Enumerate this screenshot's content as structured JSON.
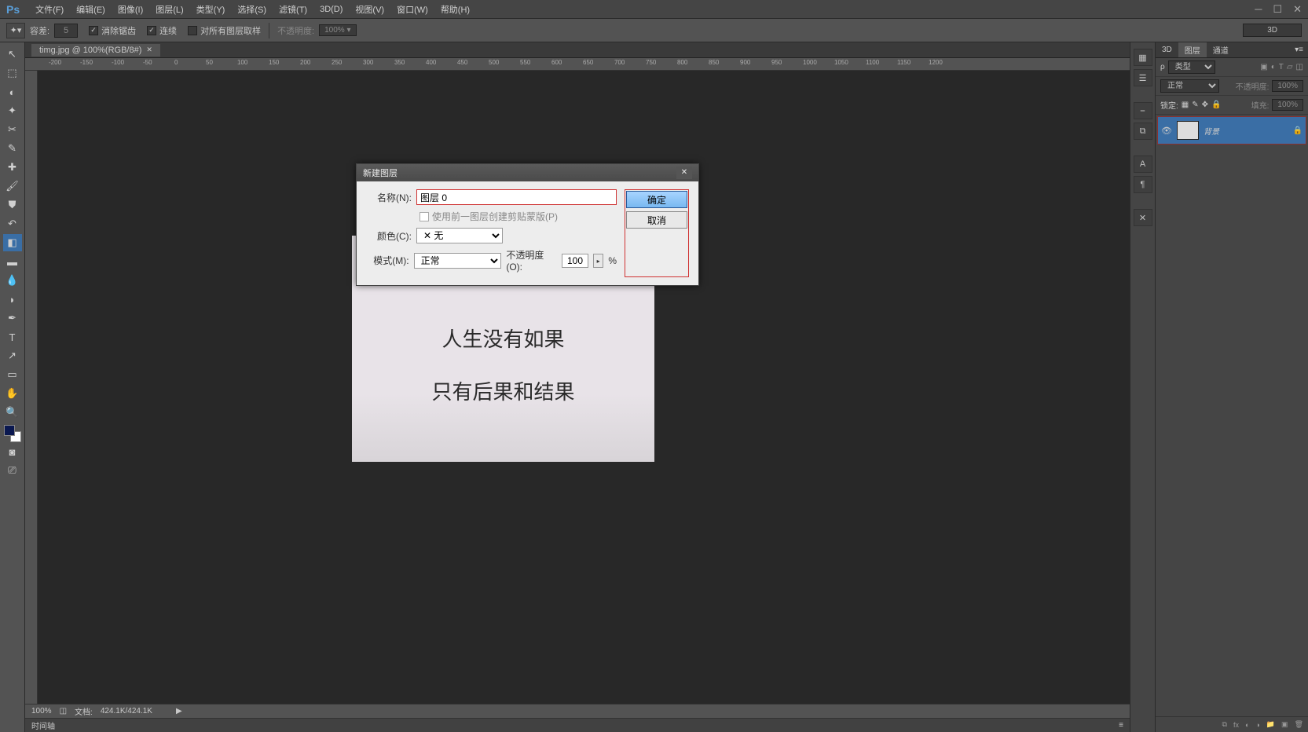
{
  "menubar": {
    "items": [
      "文件(F)",
      "编辑(E)",
      "图像(I)",
      "图层(L)",
      "类型(Y)",
      "选择(S)",
      "滤镜(T)",
      "3D(D)",
      "视图(V)",
      "窗口(W)",
      "帮助(H)"
    ]
  },
  "options": {
    "tolerance_label": "容差:",
    "tolerance_value": "5",
    "antialias": "消除锯齿",
    "contiguous": "连续",
    "all_layers": "对所有图层取样",
    "opacity_label": "不透明度:",
    "opacity_value": "100%",
    "three_d": "3D"
  },
  "document": {
    "tab_title": "timg.jpg @ 100%(RGB/8#)",
    "zoom": "100%",
    "doc_size_label": "文档:",
    "doc_size": "424.1K/424.1K",
    "timeline_label": "时间轴",
    "ruler_ticks": [
      "-200",
      "-150",
      "-100",
      "-50",
      "0",
      "50",
      "100",
      "150",
      "200",
      "250",
      "300",
      "350",
      "400",
      "450",
      "500",
      "550",
      "600",
      "650",
      "700",
      "750",
      "800",
      "850",
      "900",
      "950",
      "1000",
      "1050",
      "1100",
      "1150",
      "1200"
    ]
  },
  "canvas": {
    "line1": "人生没有如果",
    "line2": "只有后果和结果"
  },
  "panels": {
    "tabs": [
      "3D",
      "图层",
      "通道"
    ],
    "active_tab": 1,
    "type_filter": "类型",
    "blend_mode": "正常",
    "opacity_label": "不透明度:",
    "opacity_value": "100%",
    "lock_label": "锁定:",
    "fill_label": "填充:",
    "fill_value": "100%",
    "layer": {
      "name": "背景"
    }
  },
  "dialog": {
    "title": "新建图层",
    "name_label": "名称(N):",
    "name_value": "图层 0",
    "clip_label": "使用前一图层创建剪贴蒙版(P)",
    "color_label": "颜色(C):",
    "color_value": "无",
    "mode_label": "模式(M):",
    "mode_value": "正常",
    "opacity_label": "不透明度(O):",
    "opacity_value": "100",
    "percent": "%",
    "ok": "确定",
    "cancel": "取消"
  }
}
